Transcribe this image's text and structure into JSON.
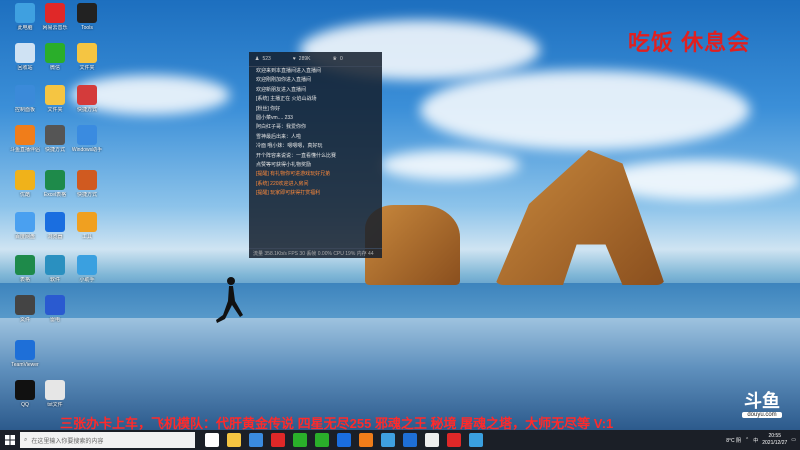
{
  "desktop_icons": [
    {
      "label": "此电脑",
      "color": "#3fa0e0"
    },
    {
      "label": "网易云音乐",
      "color": "#e02828"
    },
    {
      "label": "Tools",
      "color": "#222222"
    },
    {
      "label": "回收站",
      "color": "#cfe2f3"
    },
    {
      "label": "微信",
      "color": "#2aae2a"
    },
    {
      "label": "文件夹",
      "color": "#f5c542"
    },
    {
      "label": "控制面板",
      "color": "#3b8ad9"
    },
    {
      "label": "文件夹",
      "color": "#f5c542"
    },
    {
      "label": "快捷方式",
      "color": "#d43b3b"
    },
    {
      "label": "斗鱼直播伴侣",
      "color": "#f07d1a"
    },
    {
      "label": "快捷方式",
      "color": "#555555"
    },
    {
      "label": "Windows助手",
      "color": "#3a8be0"
    },
    {
      "label": "优酷",
      "color": "#f0b21a"
    },
    {
      "label": "Excel表格",
      "color": "#1e8a4a"
    },
    {
      "label": "快捷方式",
      "color": "#d05a20"
    },
    {
      "label": "百度网盘",
      "color": "#4aa0f0"
    },
    {
      "label": "浏览器",
      "color": "#1a6ee0"
    },
    {
      "label": "工具",
      "color": "#f0a020"
    },
    {
      "label": "表格",
      "color": "#1e8a4a"
    },
    {
      "label": "软件",
      "color": "#2a90c0"
    },
    {
      "label": "小助手",
      "color": "#3aa0e0"
    },
    {
      "label": "文件",
      "color": "#444444"
    },
    {
      "label": "雷电",
      "color": "#2a5ad0"
    },
    {
      "label": "TeamViewer",
      "color": "#1e6fd8"
    },
    {
      "label": "QQ",
      "color": "#111111"
    },
    {
      "label": "txt文件",
      "color": "#e6e6e6"
    }
  ],
  "chat_panel": {
    "tabs": [
      {
        "icon": "user-icon",
        "label": "523"
      },
      {
        "icon": "heart-icon",
        "label": "289K"
      },
      {
        "icon": "crown-icon",
        "label": "0"
      }
    ],
    "messages": [
      "欢迎来到本直播间进入直播间",
      "欢迎刚刚加你进入直播间",
      "欢迎新朋友进入直播间",
      "[系统] 主播正在 火焰山战场",
      "[粉丝] 你好",
      "圆小菜vm.... 233",
      "阿白红子哥：我爱你你",
      "雪神最后出来：人啦",
      "冷面 哦小妹：嗯嗯嗯，真好玩",
      "开个阵容来说说：一直看懂什么比赛",
      "点赞等可获得小礼物奖励",
      "[提醒] 有礼物你可进游戏玩好兄弟",
      "[系统] 220欢迎进入房间",
      "[提醒] 玩家即可获得打赏福利"
    ],
    "status": "流量 358.1Kb/s  FPS 30  丢帧 0.00%  CPU 19%  内存 44"
  },
  "overlay_title": "吃饭 休息会",
  "marquee_text": "三张办卡上车，飞机模队：代肝黄金传说 四星无尽255 邪魂之王 秘境 屠魂之塔，大师无尽等   V:1",
  "douyu_logo": {
    "name": "斗鱼",
    "sub": "douyu.com"
  },
  "taskbar": {
    "search_placeholder": "在这里输入你要搜索的内容",
    "apps": [
      "#ffffff",
      "#f5c542",
      "#3a8be0",
      "#e02828",
      "#2aae2a",
      "#2aae2a",
      "#1a6ee0",
      "#f07d1a",
      "#3fa0e0",
      "#1e6fd8",
      "#eeeeee",
      "#e02828",
      "#3aa0e0"
    ],
    "weather": "8°C 阴",
    "ime": "中",
    "time": "20:55",
    "date": "2021/12/27"
  }
}
